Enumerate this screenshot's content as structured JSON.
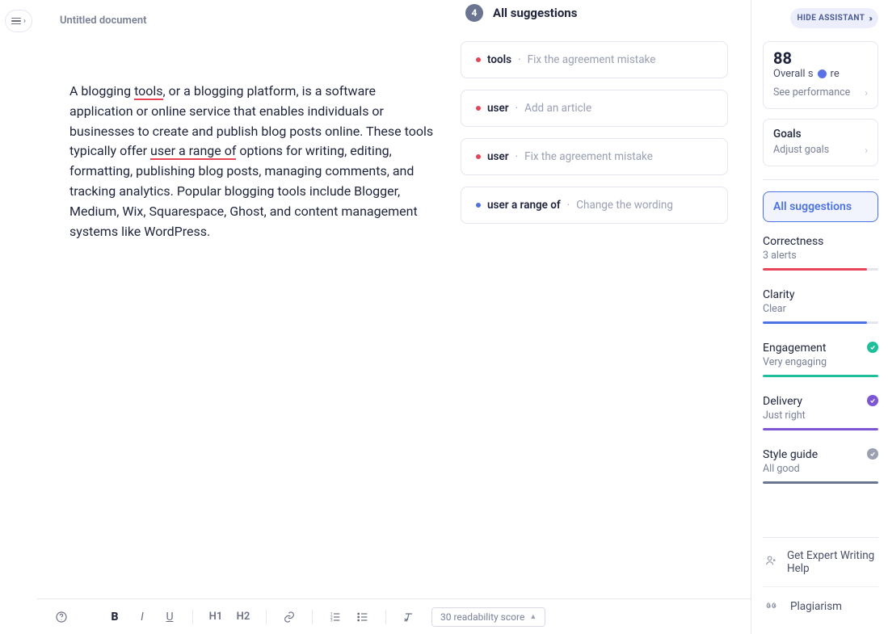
{
  "document": {
    "title": "Untitled document",
    "text_before_tools": "A blogging ",
    "tools_word": "tools",
    "text_mid1": ", or a blogging platform, is a software application or online service that enables individuals or businesses to create and publish blog posts online. These tools typically offer ",
    "user_range": "user a range of",
    "text_after": " options for writing, editing, formatting, publishing blog posts, managing comments, and tracking analytics. Popular blogging tools include Blogger, Medium, Wix, Squarespace, Ghost, and content management systems like WordPress."
  },
  "suggestions": {
    "count": "4",
    "heading": "All suggestions",
    "items": [
      {
        "dot": "red",
        "term": "tools",
        "hint": "Fix the agreement mistake"
      },
      {
        "dot": "red",
        "term": "user",
        "hint": "Add an article"
      },
      {
        "dot": "red",
        "term": "user",
        "hint": "Fix the agreement mistake"
      },
      {
        "dot": "blue",
        "term": "user a range of",
        "hint": "Change the wording"
      }
    ]
  },
  "toolbar": {
    "bold": "B",
    "italic": "I",
    "underline": "U",
    "h1": "H1",
    "h2": "H2",
    "readability": "30 readability score"
  },
  "assistant": {
    "hide_label": "HIDE ASSISTANT",
    "score": "88",
    "score_label_a": "Overall s",
    "score_label_b": "re",
    "see_perf": "See performance",
    "goals_title": "Goals",
    "goals_sub": "Adjust goals",
    "all_suggestions": "All suggestions",
    "metrics": {
      "correctness": {
        "title": "Correctness",
        "sub": "3 alerts",
        "color": "#e9455a",
        "width": "90%"
      },
      "clarity": {
        "title": "Clarity",
        "sub": "Clear",
        "color": "#4d72e3",
        "width": "90%"
      },
      "engagement": {
        "title": "Engagement",
        "sub": "Very engaging",
        "color": "#1fbf9c",
        "width": "100%",
        "badge": "#1fbf9c"
      },
      "delivery": {
        "title": "Delivery",
        "sub": "Just right",
        "color": "#7d56d6",
        "width": "100%",
        "badge": "#7d56d6"
      },
      "style": {
        "title": "Style guide",
        "sub": "All good",
        "color": "#6b7490",
        "width": "100%",
        "badge": "#9aa0b2"
      }
    },
    "links": {
      "expert": "Get Expert Writing Help",
      "plagiarism": "Plagiarism"
    }
  }
}
